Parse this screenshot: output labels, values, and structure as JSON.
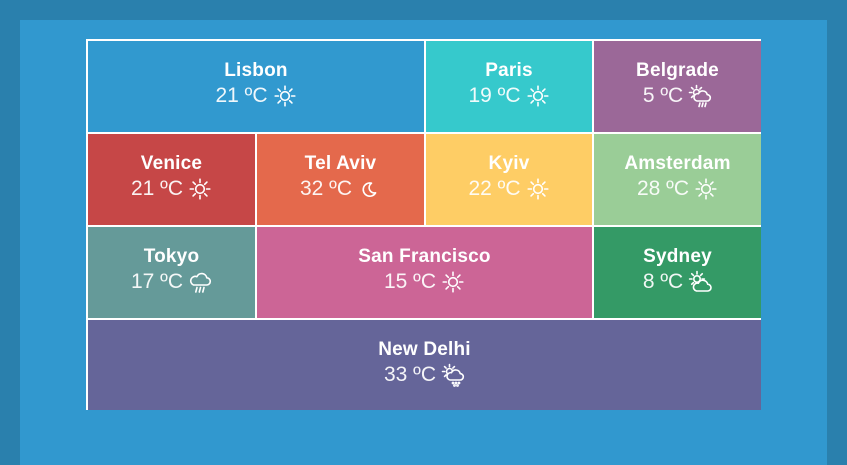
{
  "tiles": [
    {
      "city": "Lisbon",
      "temp": "21 ºC",
      "icon": "sun-icon",
      "color": "#3199cf"
    },
    {
      "city": "Paris",
      "temp": "19 ºC",
      "icon": "sun-icon",
      "color": "#36c9cc"
    },
    {
      "city": "Belgrade",
      "temp": "5 ºC",
      "icon": "sun-rain-cloud-icon",
      "color": "#9b6898"
    },
    {
      "city": "Venice",
      "temp": "21 ºC",
      "icon": "sun-icon",
      "color": "#c64747"
    },
    {
      "city": "Tel Aviv",
      "temp": "32 ºC",
      "icon": "moon-icon",
      "color": "#e4694c"
    },
    {
      "city": "Kyiv",
      "temp": "22 ºC",
      "icon": "sun-icon",
      "color": "#fecd65"
    },
    {
      "city": "Amsterdam",
      "temp": "28 ºC",
      "icon": "sun-icon",
      "color": "#9acd97"
    },
    {
      "city": "Tokyo",
      "temp": "17 ºC",
      "icon": "rain-cloud-icon",
      "color": "#659a99"
    },
    {
      "city": "San Francisco",
      "temp": "15 ºC",
      "icon": "sun-icon",
      "color": "#cc6596"
    },
    {
      "city": "Sydney",
      "temp": "8 ºC",
      "icon": "partly-cloudy-icon",
      "color": "#349a66"
    },
    {
      "city": "New Delhi",
      "temp": "33 ºC",
      "icon": "sun-drizzle-cloud-icon",
      "color": "#656599"
    }
  ]
}
